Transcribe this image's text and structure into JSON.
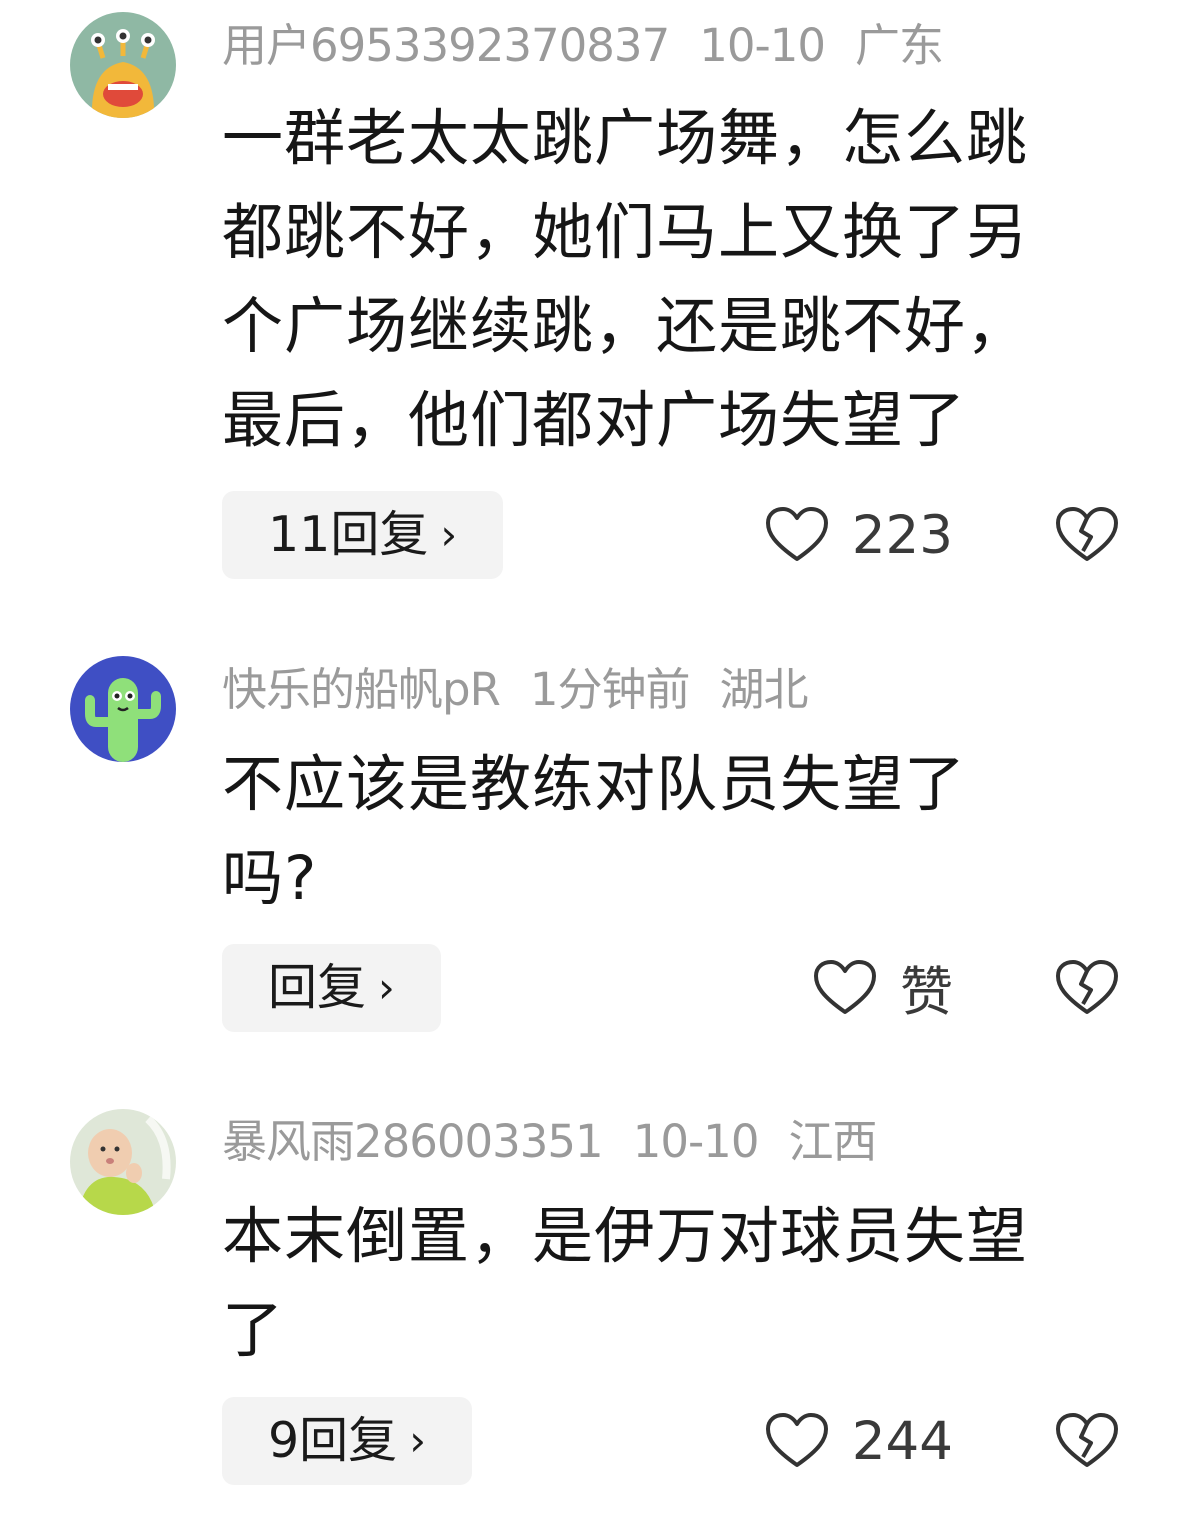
{
  "comments": [
    {
      "user": "用户6953392370837",
      "date": "10-10",
      "location": "广东",
      "lines": [
        "一群老太太跳广场舞，怎么跳",
        "都跳不好，她们马上又换了另",
        "个广场继续跳，还是跳不好，",
        "最后，他们都对广场失望了"
      ],
      "reply_label": "11回复",
      "like_count": "223",
      "avatar_icon": "alien-monster-avatar"
    },
    {
      "user": "快乐的船帆pR",
      "date": "1分钟前",
      "location": "湖北",
      "lines": [
        "不应该是教练对队员失望了",
        "吗?"
      ],
      "reply_label": "回复",
      "like_count": "赞",
      "avatar_icon": "cactus-avatar"
    },
    {
      "user": "暴风雨286003351",
      "date": "10-10",
      "location": "江西",
      "lines": [
        "本末倒置，是伊万对球员失望",
        "了"
      ],
      "reply_label": "9回复",
      "like_count": "244",
      "avatar_icon": "baby-photo-avatar"
    }
  ],
  "chevron": "›",
  "icons": {
    "like": "heart-outline-icon",
    "dislike": "broken-heart-icon"
  }
}
